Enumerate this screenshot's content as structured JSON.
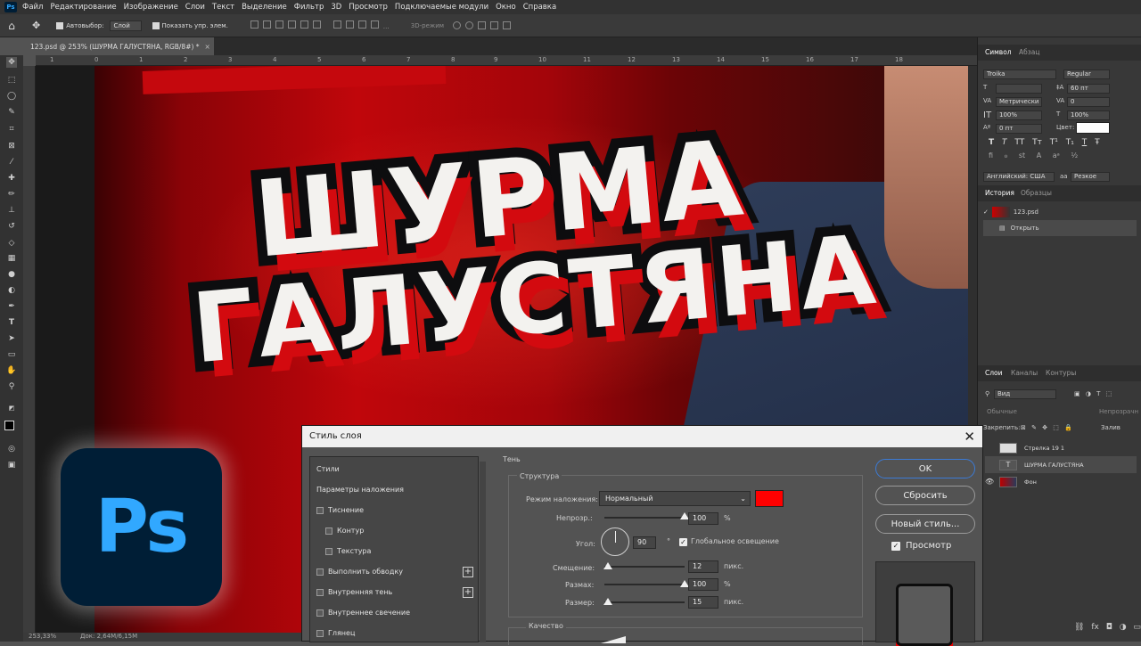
{
  "menubar": {
    "app_badge": "Ps",
    "items": [
      "Файл",
      "Редактирование",
      "Изображение",
      "Слои",
      "Текст",
      "Выделение",
      "Фильтр",
      "3D",
      "Просмотр",
      "Подключаемые модули",
      "Окно",
      "Справка"
    ]
  },
  "options": {
    "autoselect_label": "Автовыбор:",
    "autoselect_value": "Слой",
    "show_controls_label": "Показать упр. элем.",
    "mode_3d_label": "3D-режим"
  },
  "document_tab": {
    "title": "123.psd @ 253% (ШУРМА ГАЛУСТЯНА, RGB/8#) *",
    "close": "×"
  },
  "ruler_top": [
    "1",
    "0",
    "1",
    "2",
    "3",
    "4",
    "5",
    "6",
    "7",
    "8",
    "9",
    "10",
    "11",
    "12",
    "13",
    "14",
    "15",
    "16",
    "17",
    "18"
  ],
  "poster": {
    "line1": "ШУРМА",
    "line2": "ГАЛУСТЯНА"
  },
  "status": {
    "zoom": "253,33%",
    "doc": "Док: 2,64M/6,15M"
  },
  "character_panel": {
    "tabs": [
      "Символ",
      "Абзац"
    ],
    "font_family": "Troika",
    "font_style": "Regular",
    "size": "60 пт",
    "kerning": "Метрически",
    "tracking": "0",
    "vscale": "100%",
    "hscale": "100%",
    "baseline": "0 пт",
    "color_label": "Цвет:",
    "styles": [
      "T",
      "T",
      "TT",
      "Tт",
      "T¹",
      "T₁",
      "T",
      "Ŧ"
    ],
    "language": "Английский: США",
    "aa_label": "aa",
    "antialias": "Резкое"
  },
  "history_panel": {
    "tabs": [
      "История",
      "Образцы"
    ],
    "items": [
      "123.psd",
      "Открыть"
    ]
  },
  "layers_panel": {
    "tabs": [
      "Слои",
      "Каналы",
      "Контуры"
    ],
    "filter": "Вид",
    "blend": "Обычные",
    "opacity_label": "Непрозрачн",
    "lock_label": "Закрепить:",
    "fill_label": "Залив",
    "layers": [
      {
        "name": "Стрелка 19 1",
        "visible": false
      },
      {
        "name": "ШУРМА ГАЛУСТЯНА",
        "visible": false,
        "kind": "T"
      },
      {
        "name": "Фон",
        "visible": true
      }
    ]
  },
  "dialog": {
    "title": "Стиль слоя",
    "close": "✕",
    "list": [
      {
        "label": "Стили",
        "checkbox": false,
        "indent": 0,
        "plus": false
      },
      {
        "label": "Параметры наложения",
        "checkbox": false,
        "indent": 0,
        "plus": false
      },
      {
        "label": "Тиснение",
        "checkbox": true,
        "indent": 0,
        "plus": false
      },
      {
        "label": "Контур",
        "checkbox": true,
        "indent": 1,
        "plus": false
      },
      {
        "label": "Текстура",
        "checkbox": true,
        "indent": 1,
        "plus": false
      },
      {
        "label": "Выполнить обводку",
        "checkbox": true,
        "indent": 0,
        "plus": true
      },
      {
        "label": "Внутренняя тень",
        "checkbox": true,
        "indent": 0,
        "plus": true
      },
      {
        "label": "Внутреннее свечение",
        "checkbox": true,
        "indent": 0,
        "plus": false
      },
      {
        "label": "Глянец",
        "checkbox": true,
        "indent": 0,
        "plus": false
      }
    ],
    "section_title": "Тень",
    "structure_title": "Структура",
    "blend_mode_label": "Режим наложения:",
    "blend_mode_value": "Нормальный",
    "shadow_color": "#ff0000",
    "opacity_label": "Непрозр.:",
    "opacity_value": "100",
    "opacity_unit": "%",
    "opacity_level": 1.0,
    "angle_label": "Угол:",
    "angle_value": "90",
    "angle_unit": "°",
    "global_light_label": "Глобальное освещение",
    "distance_label": "Смещение:",
    "distance_value": "12",
    "distance_unit": "пикс.",
    "distance_level": 0.04,
    "spread_label": "Размах:",
    "spread_value": "100",
    "spread_unit": "%",
    "spread_level": 1.0,
    "size_label": "Размер:",
    "size_value": "15",
    "size_unit": "пикс.",
    "size_level": 0.04,
    "quality_title": "Качество",
    "buttons": {
      "ok": "OK",
      "reset": "Сбросить",
      "new_style": "Новый стиль...",
      "preview": "Просмотр"
    }
  },
  "logo": {
    "text": "Ps"
  }
}
